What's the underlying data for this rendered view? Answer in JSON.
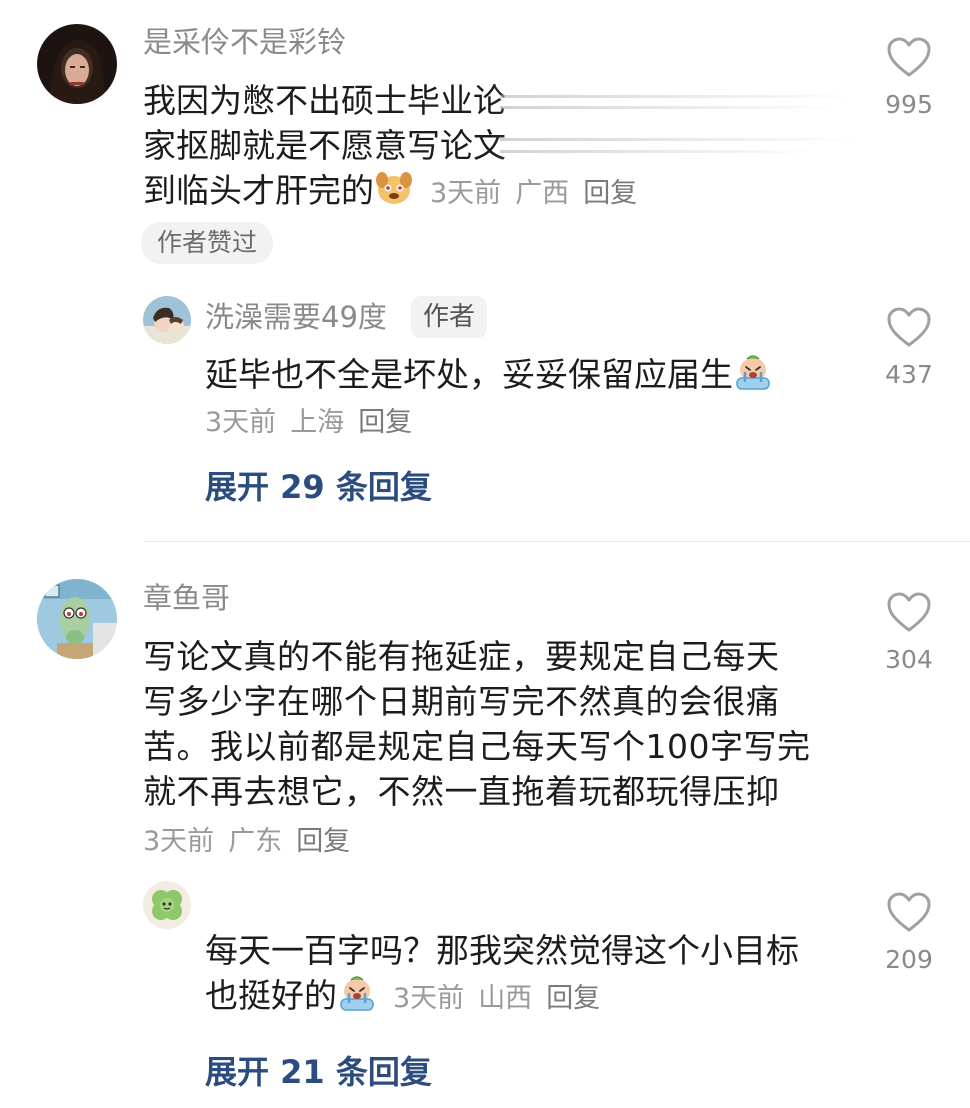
{
  "comments": [
    {
      "username": "是采伶不是彩铃",
      "text_lines": [
        "我因为憋不出硕士毕业论",
        "家抠脚就是不愿意写论文",
        "到临头才肝完的"
      ],
      "time": "3天前",
      "location": "广西",
      "reply_label": "回复",
      "author_liked_label": "作者赞过",
      "likes": "995",
      "replies": [
        {
          "username": "洗澡需要49度",
          "author_badge": "作者",
          "text_lines": [
            "延毕也不全是坏处，妥妥保留应届生"
          ],
          "time": "3天前",
          "location": "上海",
          "reply_label": "回复",
          "likes": "437"
        }
      ],
      "expand_label": "展开 29 条回复"
    },
    {
      "username": "章鱼哥",
      "text_lines": [
        "写论文真的不能有拖延症，要规定自己每天",
        "写多少字在哪个日期前写完不然真的会很痛",
        "苦。我以前都是规定自己每天写个100字写完",
        "就不再去想它，不然一直拖着玩都玩得压抑"
      ],
      "time": "3天前",
      "location": "广东",
      "reply_label": "回复",
      "likes": "304",
      "replies": [
        {
          "username": "",
          "text_lines": [
            "每天一百字吗？那我突然觉得这个小目标",
            "也挺好的"
          ],
          "time": "3天前",
          "location": "山西",
          "reply_label": "回复",
          "likes": "209"
        }
      ],
      "expand_label": "展开 21 条回复"
    }
  ],
  "icons": {
    "like": "heart-outline-icon",
    "emoji_1": "dog-face-emoji",
    "emoji_2": "crying-face-emoji"
  },
  "colors": {
    "expand_link": "#2b4c7e",
    "meta_text": "#9a9a9a",
    "username": "#8a8a8a"
  }
}
